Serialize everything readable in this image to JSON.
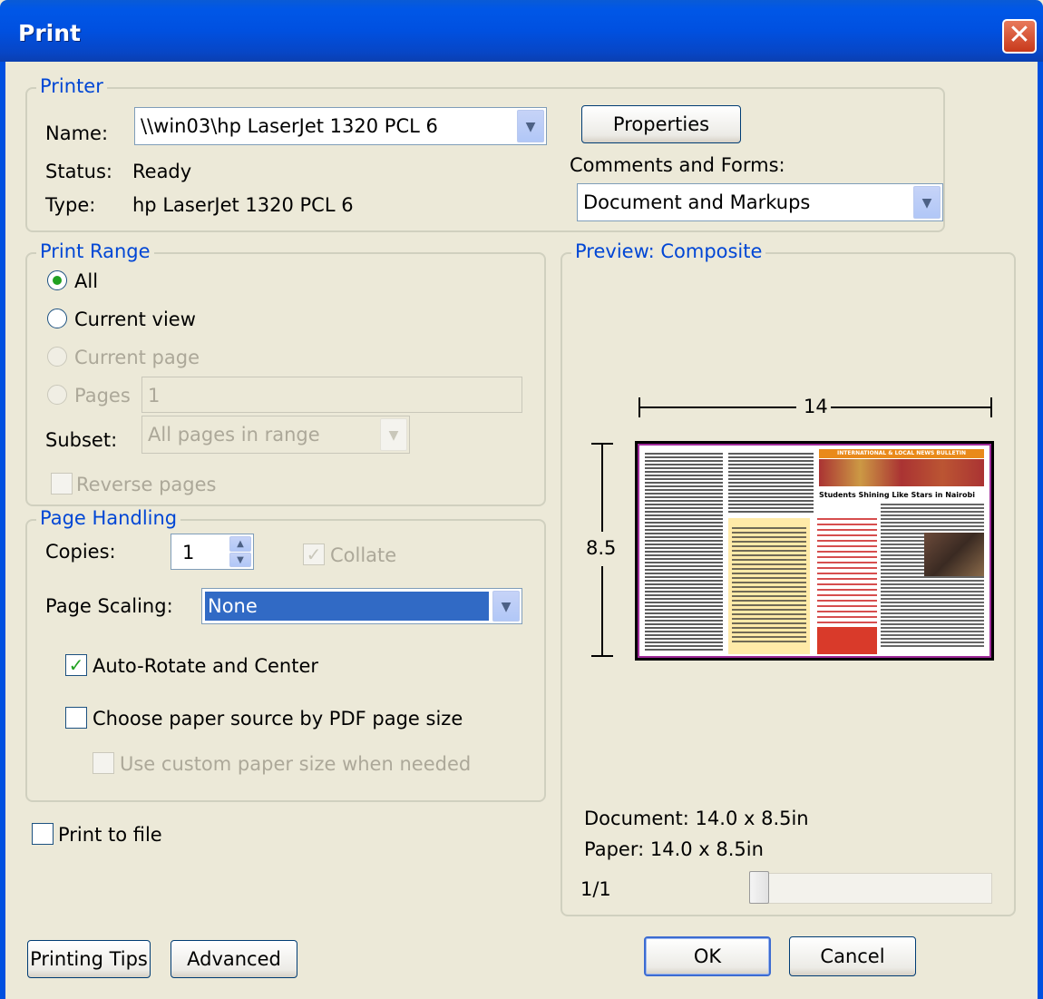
{
  "window": {
    "title": "Print",
    "close_icon": "close-icon"
  },
  "printer": {
    "legend": "Printer",
    "name_label": "Name:",
    "name_value": "\\\\win03\\hp LaserJet 1320 PCL 6",
    "status_label": "Status:",
    "status_value": "Ready",
    "type_label": "Type:",
    "type_value": "hp LaserJet 1320 PCL 6",
    "properties_button": "Properties",
    "comments_label": "Comments and Forms:",
    "comments_value": "Document and Markups"
  },
  "print_range": {
    "legend": "Print Range",
    "options": [
      {
        "label": "All",
        "selected": true,
        "enabled": true
      },
      {
        "label": "Current view",
        "selected": false,
        "enabled": true
      },
      {
        "label": "Current page",
        "selected": false,
        "enabled": false
      },
      {
        "label": "Pages",
        "selected": false,
        "enabled": false
      }
    ],
    "pages_value": "1",
    "subset_label": "Subset:",
    "subset_value": "All pages in range",
    "reverse_label": "Reverse pages"
  },
  "page_handling": {
    "legend": "Page Handling",
    "copies_label": "Copies:",
    "copies_value": "1",
    "collate_label": "Collate",
    "scaling_label": "Page Scaling:",
    "scaling_value": "None",
    "auto_rotate_label": "Auto-Rotate and Center",
    "paper_source_label": "Choose paper source by PDF page size",
    "custom_paper_label": "Use custom paper size when needed"
  },
  "print_to_file_label": "Print to file",
  "preview": {
    "legend": "Preview: Composite",
    "width_label": "14",
    "height_label": "8.5",
    "document_size": "Document: 14.0 x 8.5in",
    "paper_size": "Paper: 14.0 x 8.5in",
    "page_indicator": "1/1",
    "thumbnail": {
      "banner": "INTERNATIONAL & LOCAL NEWS BULLETIN",
      "headline": "Students Shining Like Stars in Nairobi"
    }
  },
  "buttons": {
    "printing_tips": "Printing Tips",
    "advanced": "Advanced",
    "ok": "OK",
    "cancel": "Cancel"
  },
  "colors": {
    "accent": "#0046d5",
    "titlebar": "#0050e0",
    "dialog_bg": "#ece9d8"
  }
}
